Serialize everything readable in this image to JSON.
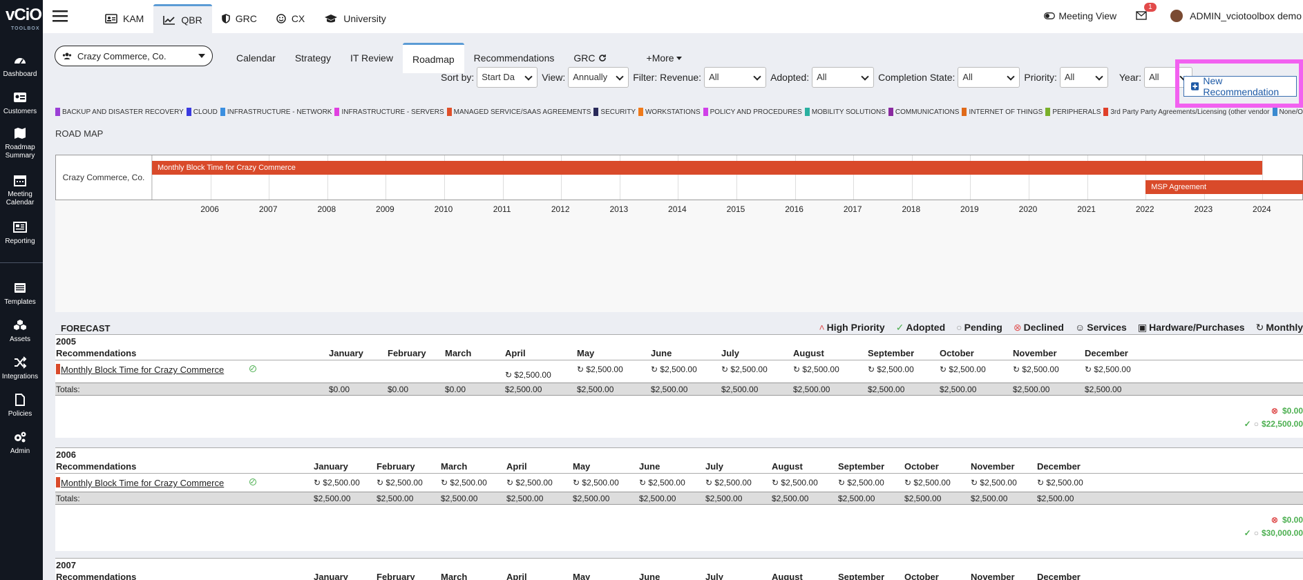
{
  "logo": {
    "main": "vCiO",
    "sub": "TOOLBOX"
  },
  "sidebar": {
    "items": [
      {
        "label": "Dashboard",
        "icon": "dashboard-icon"
      },
      {
        "label": "Customers",
        "icon": "customers-icon"
      },
      {
        "label": "Roadmap Summary",
        "icon": "map-icon"
      },
      {
        "label": "Meeting Calendar",
        "icon": "calendar-icon"
      },
      {
        "label": "Reporting",
        "icon": "reporting-icon"
      },
      {
        "label": "Templates",
        "icon": "templates-icon"
      },
      {
        "label": "Assets",
        "icon": "assets-icon"
      },
      {
        "label": "Integrations",
        "icon": "integrations-icon"
      },
      {
        "label": "Policies",
        "icon": "policies-icon"
      },
      {
        "label": "Admin",
        "icon": "admin-icon"
      }
    ]
  },
  "topnav": {
    "tabs": [
      {
        "label": "KAM",
        "icon": "id-card-icon"
      },
      {
        "label": "QBR",
        "icon": "chart-line-icon"
      },
      {
        "label": "GRC",
        "icon": "shield-icon"
      },
      {
        "label": "CX",
        "icon": "smile-icon"
      },
      {
        "label": "University",
        "icon": "graduation-cap-icon"
      }
    ],
    "active": "QBR"
  },
  "header": {
    "meeting_view": "Meeting View",
    "mail_count": "1",
    "user": "ADMIN_vciotoolbox demo"
  },
  "account_selector": {
    "value": "Crazy Commerce, Co."
  },
  "subtabs": {
    "items": [
      "Calendar",
      "Strategy",
      "IT Review",
      "Roadmap",
      "Recommendations",
      "GRC",
      "+More"
    ],
    "active": "Roadmap"
  },
  "filters": {
    "sort_label": "Sort by:",
    "sort_value": "Start Da",
    "view_label": "View:",
    "view_value": "Annually",
    "revenue_label": "Filter: Revenue:",
    "revenue_value": "All",
    "adopted_label": "Adopted:",
    "adopted_value": "All",
    "completion_label": "Completion State:",
    "completion_value": "All",
    "priority_label": "Priority:",
    "priority_value": "All",
    "year_label": "Year:",
    "year_value": "All"
  },
  "new_recommendation": "New Recommendation",
  "legend": [
    {
      "label": "BACKUP AND DISASTER RECOVERY",
      "color": "#9b3fd6"
    },
    {
      "label": "CLOUD",
      "color": "#3a3ae0"
    },
    {
      "label": "INFRASTRUCTURE - NETWORK",
      "color": "#3b8fe0"
    },
    {
      "label": "INFRASTRUCTURE - SERVERS",
      "color": "#e040e0"
    },
    {
      "label": "MANAGED SERVICE/SAAS AGREEMENTS",
      "color": "#e0502a"
    },
    {
      "label": "SECURITY",
      "color": "#2a2a5a"
    },
    {
      "label": "WORKSTATIONS",
      "color": "#f07a1a"
    },
    {
      "label": "POLICY AND PROCEDURES",
      "color": "#d040e8"
    },
    {
      "label": "MOBILITY SOLUTIONS",
      "color": "#2ab0a0"
    },
    {
      "label": "COMMUNICATIONS",
      "color": "#8a2aa0"
    },
    {
      "label": "INTERNET OF THINGS",
      "color": "#e06a1a"
    },
    {
      "label": "PERIPHERALS",
      "color": "#7ab02a"
    },
    {
      "label": "3rd Party Party Agreements/Licensing (other vendor",
      "color": "#e0402a"
    },
    {
      "label": "None/Other",
      "color": "#3a8ad0"
    }
  ],
  "roadmap": {
    "title": "ROAD MAP",
    "account": "Crazy Commerce, Co.",
    "years": [
      "2006",
      "2007",
      "2008",
      "2009",
      "2010",
      "2011",
      "2012",
      "2013",
      "2014",
      "2015",
      "2016",
      "2017",
      "2018",
      "2019",
      "2020",
      "2021",
      "2022",
      "2023",
      "2024"
    ],
    "bars": [
      {
        "label": "Monthly Block Time for Crazy Commerce",
        "start": "2005",
        "end": "2024",
        "color": "#d94a2a"
      },
      {
        "label": "MSP Agreement",
        "start": "2022",
        "end": "2025",
        "color": "#d94a2a"
      }
    ]
  },
  "forecast": {
    "title": "FORECAST",
    "legend": [
      {
        "label": "High Priority",
        "icon": "double-chevron-up-icon",
        "color": "#e05555"
      },
      {
        "label": "Adopted",
        "icon": "check-circle-icon",
        "color": "#4caf50"
      },
      {
        "label": "Pending",
        "icon": "circle-icon",
        "color": "#999"
      },
      {
        "label": "Declined",
        "icon": "x-circle-icon",
        "color": "#e05555"
      },
      {
        "label": "Services",
        "icon": "user-icon",
        "color": "#222"
      },
      {
        "label": "Hardware/Purchases",
        "icon": "box-icon",
        "color": "#222"
      },
      {
        "label": "Monthly",
        "icon": "refresh-icon",
        "color": "#222"
      }
    ],
    "rec_header": "Recommendations",
    "totals_label": "Totals:",
    "years": [
      {
        "year": "2005",
        "months": [
          "January",
          "February",
          "March",
          "April",
          "May",
          "June",
          "July",
          "August",
          "September",
          "October",
          "November",
          "December"
        ],
        "rows": [
          {
            "name": "Monthly Block Time for Crazy Commerce",
            "cells": [
              "",
              "",
              "",
              "$2,500.00",
              "$2,500.00",
              "$2,500.00",
              "$2,500.00",
              "$2,500.00",
              "$2,500.00",
              "$2,500.00",
              "$2,500.00",
              "$2,500.00"
            ]
          }
        ],
        "totals": [
          "$0.00",
          "$0.00",
          "$0.00",
          "$2,500.00",
          "$2,500.00",
          "$2,500.00",
          "$2,500.00",
          "$2,500.00",
          "$2,500.00",
          "$2,500.00",
          "$2,500.00",
          "$2,500.00"
        ],
        "declined_total": "$0.00",
        "adopted_total": "$22,500.00"
      },
      {
        "year": "2006",
        "months": [
          "January",
          "February",
          "March",
          "April",
          "May",
          "June",
          "July",
          "August",
          "September",
          "October",
          "November",
          "December"
        ],
        "rows": [
          {
            "name": "Monthly Block Time for Crazy Commerce",
            "cells": [
              "$2,500.00",
              "$2,500.00",
              "$2,500.00",
              "$2,500.00",
              "$2,500.00",
              "$2,500.00",
              "$2,500.00",
              "$2,500.00",
              "$2,500.00",
              "$2,500.00",
              "$2,500.00",
              "$2,500.00"
            ]
          }
        ],
        "totals": [
          "$2,500.00",
          "$2,500.00",
          "$2,500.00",
          "$2,500.00",
          "$2,500.00",
          "$2,500.00",
          "$2,500.00",
          "$2,500.00",
          "$2,500.00",
          "$2,500.00",
          "$2,500.00",
          "$2,500.00"
        ],
        "declined_total": "$0.00",
        "adopted_total": "$30,000.00"
      },
      {
        "year": "2007",
        "months": [
          "January",
          "February",
          "March",
          "April",
          "May",
          "June",
          "July",
          "August",
          "September",
          "October",
          "November",
          "December"
        ]
      }
    ]
  }
}
